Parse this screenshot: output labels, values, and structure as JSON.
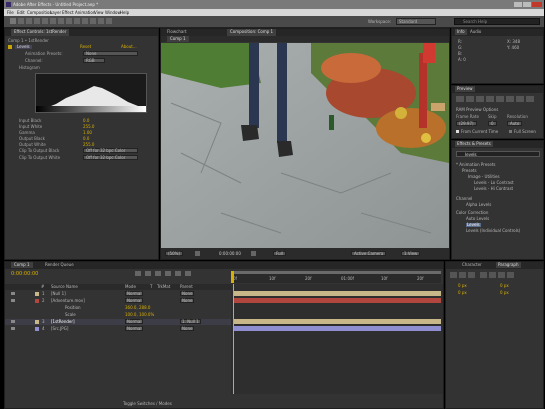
{
  "app": {
    "title": "Adobe After Effects - Untitled Project.aep *",
    "menu": [
      "File",
      "Edit",
      "Composition",
      "Layer",
      "Effect",
      "Animation",
      "View",
      "Window",
      "Help"
    ],
    "workspace_label": "Workspace:",
    "workspace_value": "Standard",
    "search_placeholder": "Search Help"
  },
  "effect_controls": {
    "tab_label": "Effect Controls: 1stRender",
    "subtitle": "Comp 1 • 1stRender",
    "effect_name": "Levels",
    "reset_label": "Reset",
    "about_label": "About...",
    "params": [
      {
        "label": "Animation Presets:",
        "value": "None"
      },
      {
        "label": "Channel:",
        "value": "RGB"
      },
      {
        "label": "Histogram",
        "value": ""
      }
    ],
    "levels": [
      {
        "label": "Input Black",
        "value": "0.0"
      },
      {
        "label": "Input White",
        "value": "255.0"
      },
      {
        "label": "Gamma",
        "value": "1.00"
      },
      {
        "label": "Output Black",
        "value": "0.0"
      },
      {
        "label": "Output White",
        "value": "255.0"
      },
      {
        "label": "Clip To Output Black",
        "value": "Off for 32 bpc Color"
      },
      {
        "label": "Clip To Output White",
        "value": "Off for 32 bpc Color"
      }
    ]
  },
  "composition": {
    "tabs": [
      "Comp 1",
      "Composition: Comp 1"
    ],
    "tab2": "Flowchart",
    "zoom": "(50%)",
    "timecode": "0:00:00:00",
    "resolution": "Full",
    "camera": "Active Camera",
    "view": "1 View"
  },
  "info_panel": {
    "tabs": [
      "Info",
      "Audio"
    ],
    "lines": [
      "R:",
      "G:",
      "B:",
      "A: 0"
    ],
    "coords": [
      "X: 348",
      "Y: 460"
    ]
  },
  "preview_panel": {
    "tab": "Preview",
    "ram_label": "RAM Preview Options",
    "frame_rate_label": "Frame Rate",
    "skip_label": "Skip",
    "resolution_label": "Resolution",
    "frame_rate": "(29.97)",
    "skip": "0",
    "resolution": "Auto",
    "from_current": "From Current Time",
    "full_screen": "Full Screen"
  },
  "effects_presets": {
    "tab": "Effects & Presets",
    "search_value": "levels",
    "items": [
      "* Animation Presets",
      "Presets",
      "Image - Utilities",
      "Levels - Lo Contrast",
      "Levels - Hi Contrast",
      "Channel",
      "Alpha Levels",
      "Color Correction",
      "Auto Levels",
      "Levels",
      "Levels (Individual Controls)"
    ]
  },
  "timeline": {
    "tabs": [
      "Comp 1",
      "Render Queue"
    ],
    "timecode": "0:00:00:00",
    "columns": [
      "#",
      "Source Name",
      "Mode",
      "T",
      "TrkMat",
      "Parent"
    ],
    "layers": [
      {
        "num": "1",
        "name": "[Null 1]",
        "mode": "Normal",
        "parent": "None",
        "color": "#c8b889"
      },
      {
        "num": "2",
        "name": "[Adventure.mov]",
        "mode": "Normal",
        "parent": "None",
        "color": "#b1463e"
      },
      {
        "num": "",
        "name": "Position",
        "mode": "",
        "parent": "",
        "color": ""
      },
      {
        "num": "",
        "name": "Scale",
        "mode": "",
        "parent": "",
        "color": ""
      },
      {
        "num": "3",
        "name": "[1stRender]",
        "mode": "Normal",
        "parent": "1. Null 1",
        "color": "#c8b889"
      },
      {
        "num": "4",
        "name": "[Src.JPG]",
        "mode": "Normal",
        "parent": "None",
        "color": "#8e8ed0"
      }
    ],
    "switches_label": "Toggle Switches / Modes",
    "ruler": [
      "0f",
      "10f",
      "20f",
      "01:00f",
      "10f",
      "20f"
    ]
  },
  "char_panel": {
    "tabs": [
      "Character",
      "Paragraph"
    ]
  },
  "colors": {
    "accent": "#d9b000",
    "panel": "#333333",
    "bar_tan": "#c8b889",
    "bar_red": "#b1463e",
    "bar_blue": "#8e8ed0",
    "bar_gold": "#d4aa2b"
  }
}
